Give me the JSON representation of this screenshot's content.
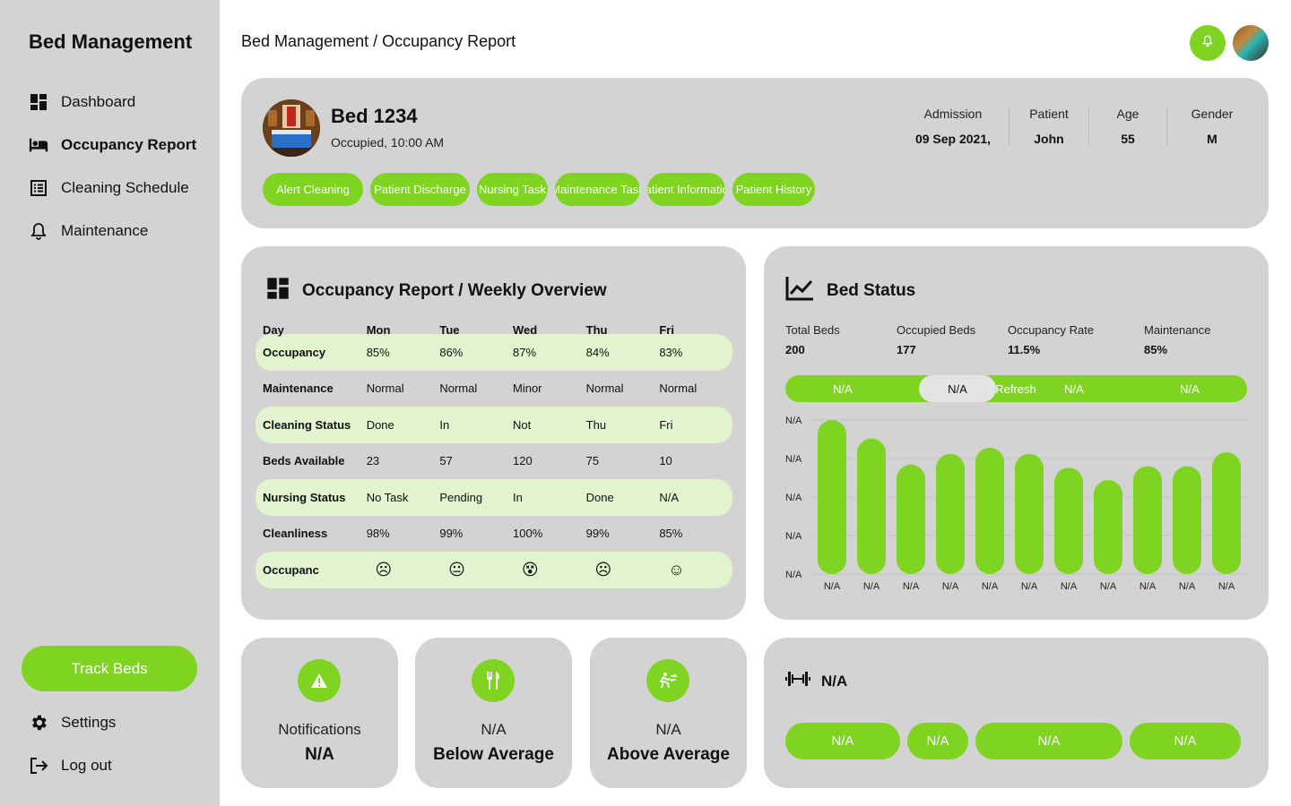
{
  "sidebar": {
    "brand": "Bed Management",
    "nav": [
      {
        "label": "Dashboard",
        "icon": "dashboard-icon"
      },
      {
        "label": "Occupancy Report",
        "icon": "bed-icon",
        "active": true
      },
      {
        "label": "Cleaning Schedule",
        "icon": "list-icon"
      },
      {
        "label": "Maintenance",
        "icon": "bell-icon"
      }
    ],
    "track_button": "Track Beds",
    "settings": "Settings",
    "logout": "Log out"
  },
  "header": {
    "breadcrumb": "Bed Management / Occupancy Report"
  },
  "patient": {
    "bed": "Bed 1234",
    "status": "Occupied, 10:00 AM",
    "stats": [
      {
        "label": "Admission",
        "value": "09 Sep 2021,"
      },
      {
        "label": "Patient",
        "value": "John"
      },
      {
        "label": "Age",
        "value": "55"
      },
      {
        "label": "Gender",
        "value": "M"
      }
    ],
    "actions": [
      "Alert Cleaning",
      "Patient Discharge",
      "Nursing Task",
      "Maintenance Task",
      "Patient Information",
      "Patient History"
    ]
  },
  "weekly": {
    "title": "Occupancy Report / Weekly Overview",
    "headers": [
      "Day",
      "Mon",
      "Tue",
      "Wed",
      "Thu",
      "Fri"
    ],
    "rows": [
      {
        "label": "Occupancy",
        "cells": [
          "85%",
          "86%",
          "87%",
          "84%",
          "83%"
        ]
      },
      {
        "label": "Maintenance",
        "cells": [
          "Normal",
          "Normal",
          "Minor",
          "Normal",
          "Normal"
        ]
      },
      {
        "label": "Cleaning Status",
        "cells": [
          "Done",
          "In",
          "Not",
          "Thu",
          "Fri"
        ]
      },
      {
        "label": "Beds Available",
        "cells": [
          "23",
          "57",
          "120",
          "75",
          "10"
        ]
      },
      {
        "label": "Nursing Status",
        "cells": [
          "No Task",
          "Pending",
          "In",
          "Done",
          "N/A"
        ]
      },
      {
        "label": "Cleanliness",
        "cells": [
          "98%",
          "99%",
          "100%",
          "99%",
          "85%"
        ]
      },
      {
        "label": "Occupanc",
        "cells": [
          "☹",
          "😐",
          "😵",
          "☹",
          "☺"
        ]
      }
    ]
  },
  "bed_status": {
    "title": "Bed Status",
    "stats": [
      {
        "label": "Total Beds",
        "value": "200"
      },
      {
        "label": "Occupied Beds",
        "value": "177"
      },
      {
        "label": "Occupancy Rate",
        "value": "11.5%"
      },
      {
        "label": "Maintenance",
        "value": "85%"
      }
    ],
    "toggle": [
      "N/A",
      "N/A",
      "Refresh",
      "N/A",
      "N/A"
    ]
  },
  "chart_data": {
    "type": "bar",
    "categories": [
      "N/A",
      "N/A",
      "N/A",
      "N/A",
      "N/A",
      "N/A",
      "N/A",
      "N/A",
      "N/A",
      "N/A",
      "N/A"
    ],
    "values": [
      100,
      88,
      71,
      78,
      82,
      78,
      69,
      61,
      70,
      70,
      79
    ],
    "y_tick_labels": [
      "N/A",
      "N/A",
      "N/A",
      "N/A",
      "N/A"
    ],
    "ylim": [
      0,
      100
    ],
    "grid": true,
    "color": "#7fd321"
  },
  "tiles": [
    {
      "label": "Notifications",
      "value": "N/A",
      "icon": "warning-icon"
    },
    {
      "label": "N/A",
      "value": "Below Average",
      "icon": "utensils-icon"
    },
    {
      "label": "N/A",
      "value": "Above Average",
      "icon": "transfer-icon"
    }
  ],
  "equipment": {
    "title": "N/A",
    "icon": "dumbbell-icon",
    "pills": [
      "N/A",
      "N/A",
      "N/A",
      "N/A"
    ]
  }
}
